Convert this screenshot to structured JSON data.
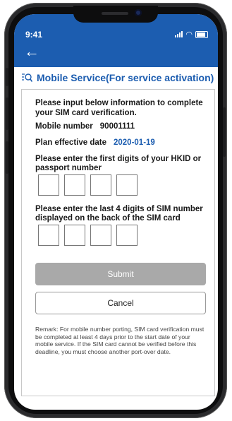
{
  "status_bar": {
    "time": "9:41"
  },
  "header": {
    "back_icon": "back-arrow-icon",
    "title": "Mobile Service(For service activation)",
    "title_icon": "search-list-icon"
  },
  "form": {
    "intro": "Please input below information to complete your SIM card verification.",
    "mobile_label": "Mobile number",
    "mobile_value": "90001111",
    "plan_label": "Plan effective date",
    "plan_value": "2020-01-19",
    "hkid_prompt": "Please enter the first digits of your  HKID or passport number",
    "sim_prompt": "Please enter the last 4 digits of SIM number displayed on the back of the SIM card",
    "submit_label": "Submit",
    "cancel_label": "Cancel",
    "remark": "Remark: For mobile number porting, SIM card verification must be completed at least 4 days prior to the start date of your mobile service. If the SIM card cannot be verified before this deadline, you must choose another port-over date."
  },
  "colors": {
    "primary": "#1c5db0",
    "disabled": "#a9a9a9"
  }
}
